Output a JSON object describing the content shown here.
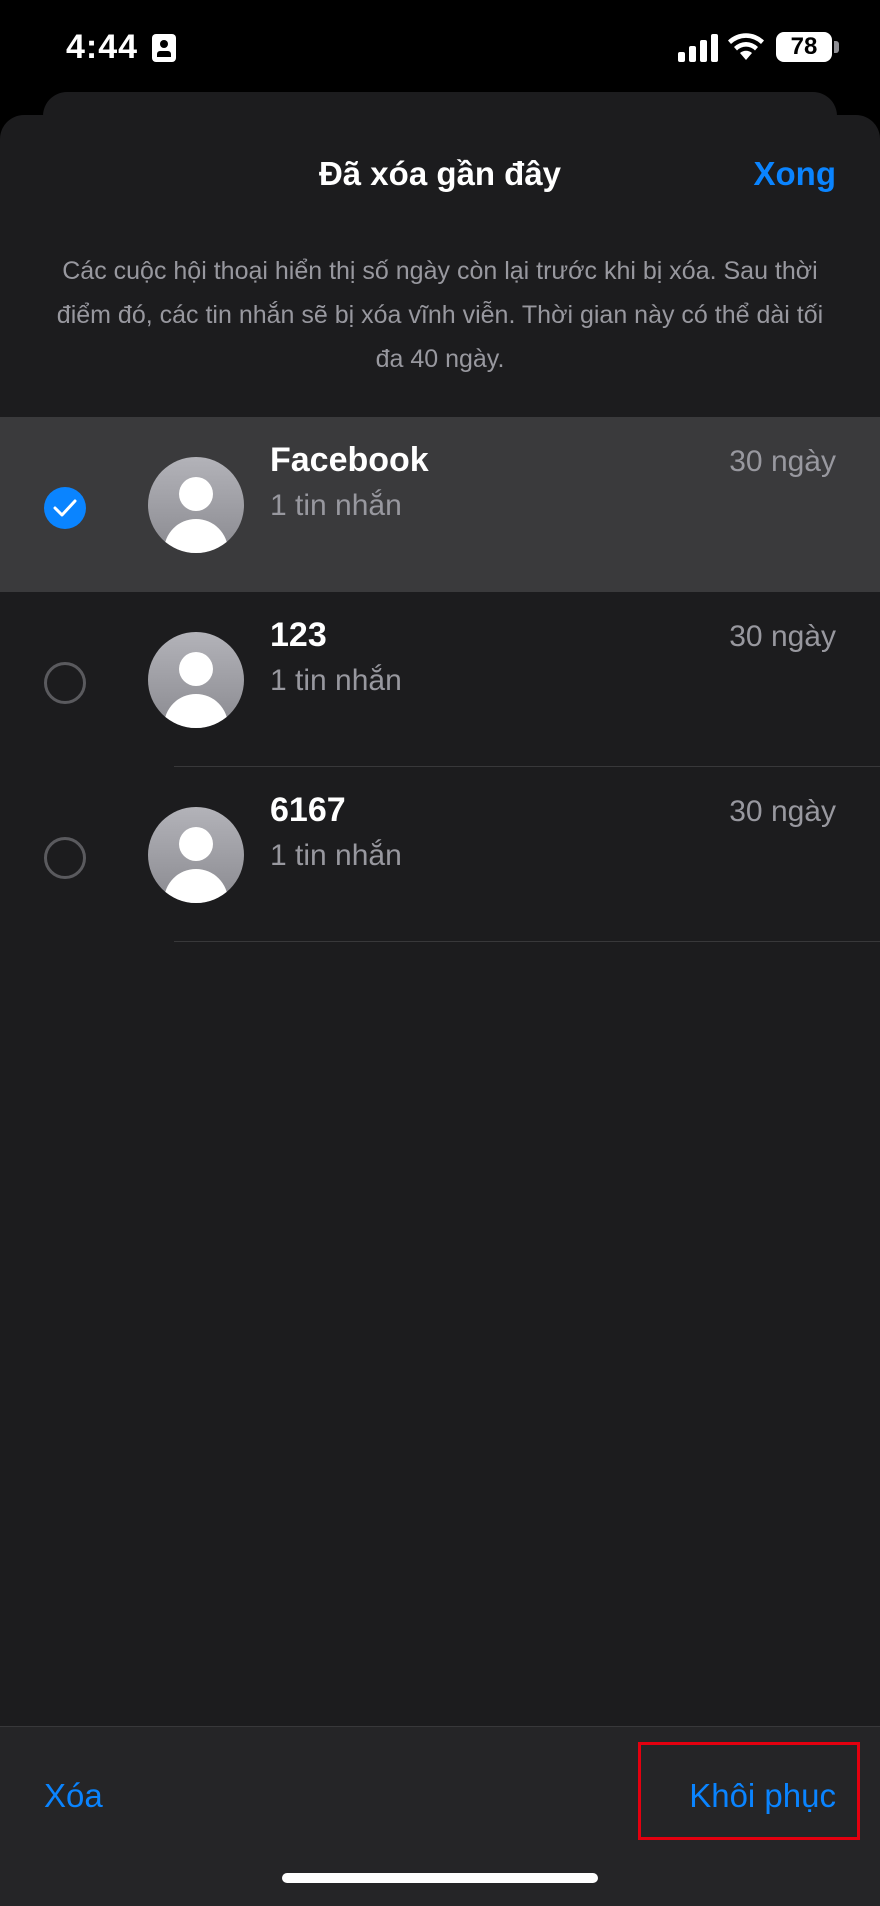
{
  "status_bar": {
    "time": "4:44",
    "battery": "78",
    "icons": [
      "id-card-icon",
      "cellular-signal-icon",
      "wifi-icon",
      "battery-icon"
    ]
  },
  "header": {
    "title": "Đã xóa gần đây",
    "done_label": "Xong"
  },
  "info": {
    "text": "Các cuộc hội thoại hiển thị số ngày còn lại trước khi bị xóa. Sau thời điểm đó, các tin nhắn sẽ bị xóa vĩnh viễn. Thời gian này có thể dài tối đa 40 ngày."
  },
  "conversations": [
    {
      "name": "Facebook",
      "subtitle": "1 tin nhắn",
      "days": "30 ngày",
      "selected": true
    },
    {
      "name": "123",
      "subtitle": "1 tin nhắn",
      "days": "30 ngày",
      "selected": false
    },
    {
      "name": "6167",
      "subtitle": "1 tin nhắn",
      "days": "30 ngày",
      "selected": false
    }
  ],
  "toolbar": {
    "delete_label": "Xóa",
    "restore_label": "Khôi phục"
  },
  "colors": {
    "accent": "#0a84ff",
    "highlight": "#e3000f",
    "background": "#1c1c1e"
  }
}
